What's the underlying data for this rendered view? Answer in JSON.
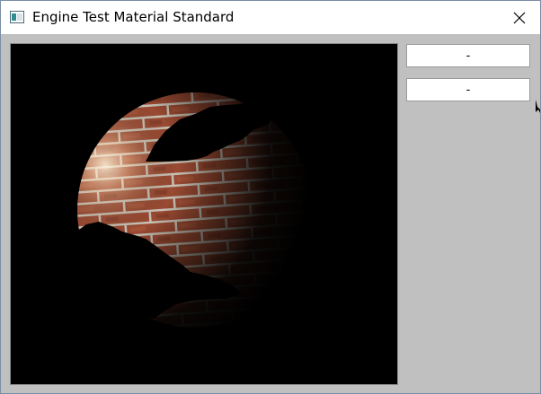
{
  "window": {
    "title": "Engine Test Material Standard",
    "close_glyph": "✕"
  },
  "icons": {
    "app": "app-window-icon",
    "close": "close-icon"
  },
  "viewport": {
    "content": "lit brick-textured sphere with alpha-cutout holes on black background"
  },
  "buttons": [
    {
      "label": "-"
    },
    {
      "label": "-"
    }
  ],
  "colors": {
    "client_background": "#c0c0c0",
    "viewport_background": "#000000",
    "titlebar": "#ffffff"
  }
}
